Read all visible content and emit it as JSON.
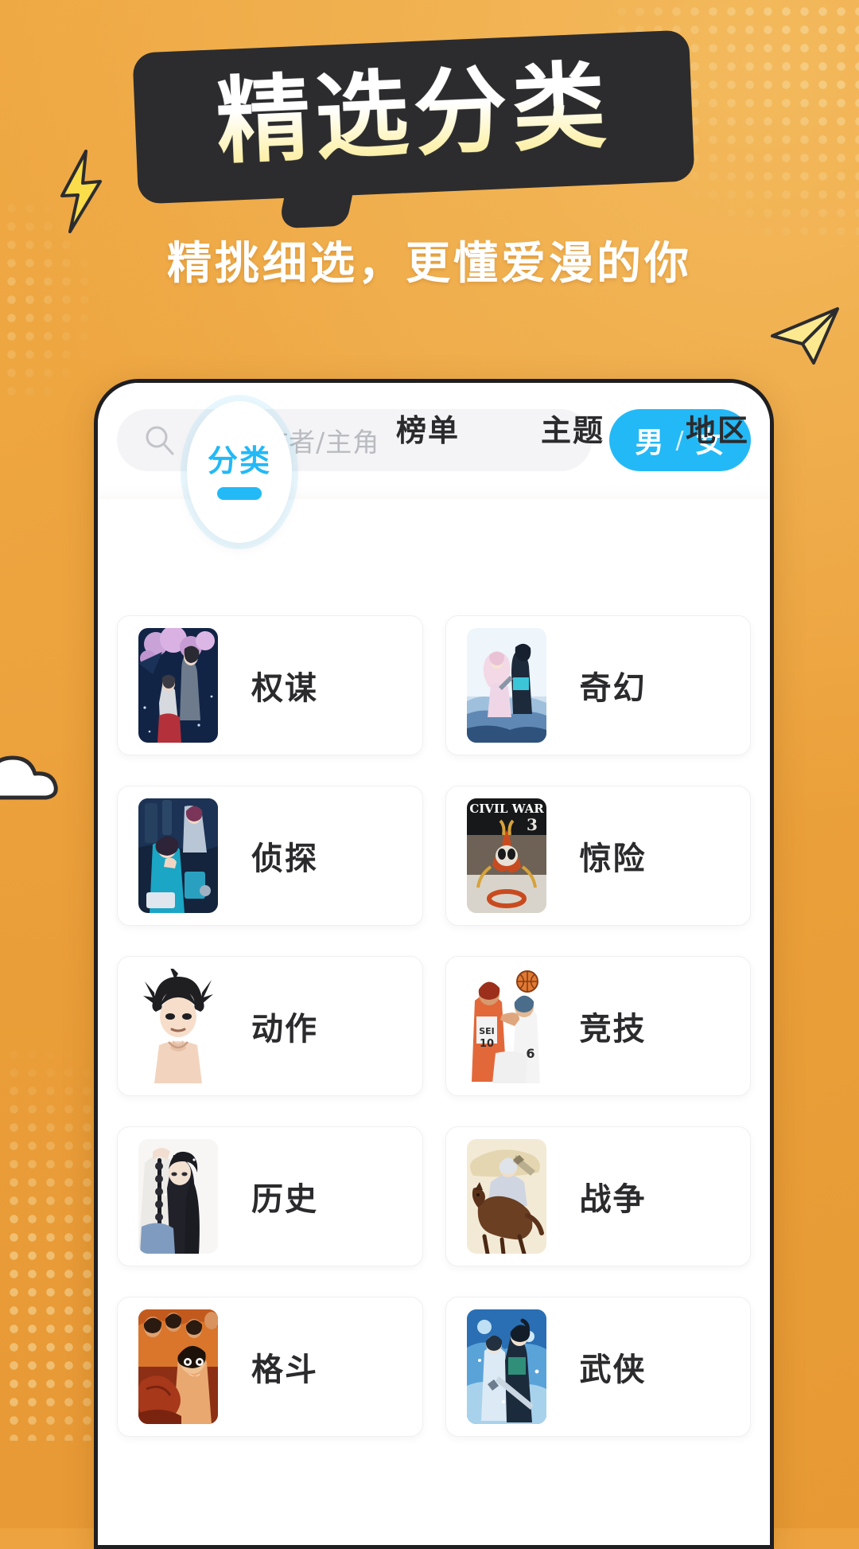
{
  "header": {
    "title": "精选分类",
    "subtitle": "精挑细选，更懂爱漫的你",
    "title_bg_color": "#2c2c2e",
    "page_bg_color": "#eda33f"
  },
  "search": {
    "placeholder": "漫画/作者/主角",
    "value": "",
    "icon": "search-icon"
  },
  "gender_toggle": {
    "male": "男",
    "separator": "/",
    "female": "女",
    "active": "男",
    "accent_color": "#23b9f7"
  },
  "tabs": [
    {
      "label": "分类",
      "active": true
    },
    {
      "label": "榜单",
      "active": false
    },
    {
      "label": "主题",
      "active": false
    },
    {
      "label": "地区",
      "active": false
    }
  ],
  "categories": [
    {
      "label": "权谋",
      "art": "quanmou"
    },
    {
      "label": "奇幻",
      "art": "qihuan"
    },
    {
      "label": "侦探",
      "art": "zhentan"
    },
    {
      "label": "惊险",
      "art": "jingxian",
      "cover_text": "CIVIL WAR",
      "cover_number": "3"
    },
    {
      "label": "动作",
      "art": "dongzuo"
    },
    {
      "label": "竞技",
      "art": "jingji",
      "cover_text": "SEI",
      "cover_number": "6"
    },
    {
      "label": "历史",
      "art": "lishi"
    },
    {
      "label": "战争",
      "art": "zhanzheng"
    },
    {
      "label": "格斗",
      "art": "gedou"
    },
    {
      "label": "武侠",
      "art": "wuxia"
    }
  ]
}
